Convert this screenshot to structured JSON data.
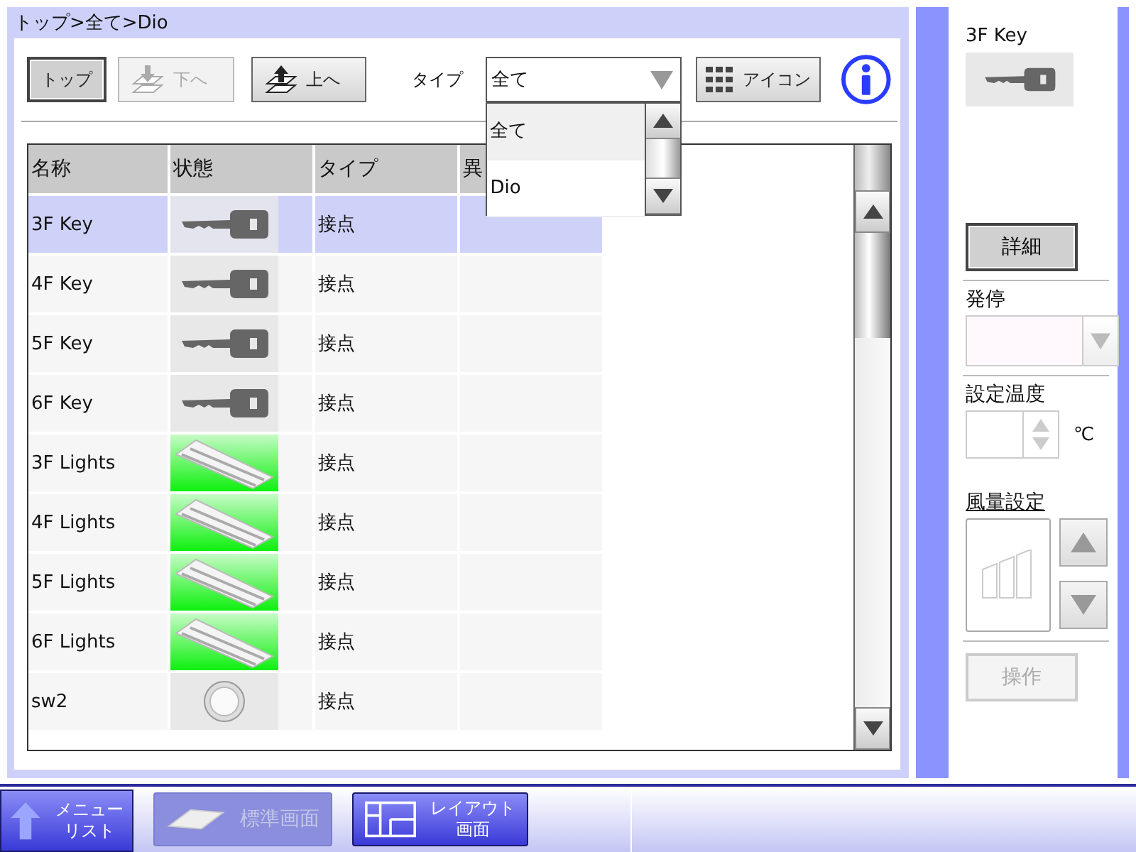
{
  "breadcrumb": "トップ>全て>Dio",
  "toolbar": {
    "buttons": [
      {
        "label": "トップ",
        "kind": "top",
        "disabled": false
      },
      {
        "label": "下へ",
        "kind": "down",
        "disabled": true
      },
      {
        "label": "上へ",
        "kind": "up",
        "disabled": false
      }
    ],
    "type_label": "タイプ",
    "type_select": {
      "value": "全て",
      "expanded": true,
      "options": [
        {
          "label": "全て",
          "selected": true
        },
        {
          "label": "Dio",
          "selected": false
        }
      ]
    },
    "icon_button": "アイコン"
  },
  "table": {
    "columns": [
      "名称",
      "状態",
      "タイプ",
      "異"
    ],
    "rows": [
      {
        "name": "3F Key",
        "kind": "key",
        "type": "接点",
        "selected": true
      },
      {
        "name": "4F Key",
        "kind": "key",
        "type": "接点",
        "selected": false
      },
      {
        "name": "5F Key",
        "kind": "key",
        "type": "接点",
        "selected": false
      },
      {
        "name": "6F Key",
        "kind": "key",
        "type": "接点",
        "selected": false
      },
      {
        "name": "3F Lights",
        "kind": "light",
        "type": "接点",
        "selected": false
      },
      {
        "name": "4F Lights",
        "kind": "light",
        "type": "接点",
        "selected": false
      },
      {
        "name": "5F Lights",
        "kind": "light",
        "type": "接点",
        "selected": false
      },
      {
        "name": "6F Lights",
        "kind": "light",
        "type": "接点",
        "selected": false
      },
      {
        "name": "sw2",
        "kind": "switch",
        "type": "接点",
        "selected": false
      }
    ]
  },
  "detail": {
    "title": "3F Key",
    "kind": "key",
    "detail_button": "詳細",
    "run_label": "発停",
    "temp_label": "設定温度",
    "temp_unit": "℃",
    "fan_label": "風量設定",
    "operate_button": {
      "label": "操作",
      "disabled": true
    }
  },
  "taskbar": [
    {
      "lines": [
        "メニュー",
        "リスト"
      ],
      "kind": "menu",
      "disabled": false
    },
    {
      "lines": [
        "標準画面"
      ],
      "kind": "standard",
      "disabled": true
    },
    {
      "lines": [
        "レイアウト",
        "画面"
      ],
      "kind": "layout",
      "disabled": false
    }
  ]
}
